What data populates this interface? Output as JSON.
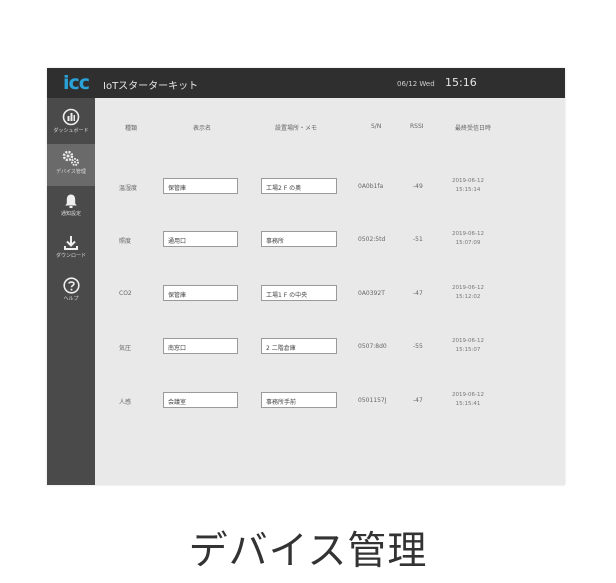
{
  "header": {
    "logo": "icc",
    "title": "IoTスターターキット",
    "date": "06/12 Wed",
    "time": "15:16"
  },
  "sidebar": {
    "items": [
      {
        "label": "ダッシュボード",
        "icon": "dashboard-icon"
      },
      {
        "label": "デバイス管理",
        "icon": "gears-icon",
        "active": true
      },
      {
        "label": "通知設定",
        "icon": "bell-icon"
      },
      {
        "label": "ダウンロード",
        "icon": "download-icon"
      },
      {
        "label": "ヘルプ",
        "icon": "help-icon"
      }
    ]
  },
  "table": {
    "headers": [
      "種類",
      "表示名",
      "設置場所・メモ",
      "S/N",
      "RSSI",
      "最終受信日時"
    ],
    "rows": [
      {
        "type": "温湿度",
        "name": "保管庫",
        "memo": "工場2 F の奥",
        "sn": "0A0b1fa",
        "rssi": "-49",
        "date": "2019-06-12",
        "time": "15:15:14"
      },
      {
        "type": "照度",
        "name": "通用口",
        "memo": "事務所",
        "sn": "0502:5td",
        "rssi": "-51",
        "date": "2019-06-12",
        "time": "15:07:09"
      },
      {
        "type": "CO2",
        "name": "保管庫",
        "memo": "工場1 F の中央",
        "sn": "0A0392T",
        "rssi": "-47",
        "date": "2019-06-12",
        "time": "15:12:02"
      },
      {
        "type": "気圧",
        "name": "南窓口",
        "memo": "2 二階倉庫",
        "sn": "0507:8d0",
        "rssi": "-55",
        "date": "2019-06-12",
        "time": "15:15:07"
      },
      {
        "type": "人感",
        "name": "会議室",
        "memo": "事務所手前",
        "sn": "0501157J",
        "rssi": "-47",
        "date": "2019-06-12",
        "time": "15:15:41"
      }
    ]
  },
  "caption": "デバイス管理"
}
